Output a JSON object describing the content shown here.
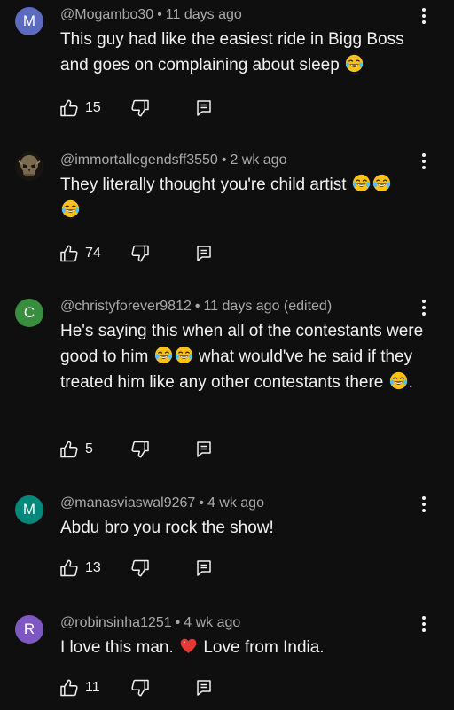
{
  "colors": {
    "background": "#0f0f0f",
    "primary_text": "#f1f1f1",
    "secondary_text": "#aaaaaa"
  },
  "comments": [
    {
      "avatar_letter": "M",
      "avatar_color": "#5c6bc0",
      "username": "@Mogambo30",
      "separator": "•",
      "time": "11 days ago",
      "text_parts": [
        "This guy had like the easiest ride in Bigg Boss and goes on complaining about sleep "
      ],
      "likes": "15"
    },
    {
      "avatar_icon": "skull-avatar-icon",
      "username": "@immortallegendsff3550",
      "separator": "•",
      "time": "2 wk ago",
      "text_parts": [
        "They literally thought you're child artist "
      ],
      "likes": "74"
    },
    {
      "avatar_letter": "C",
      "avatar_color": "#388e3c",
      "username": "@christyforever9812",
      "separator": "•",
      "time": "11 days ago (edited)",
      "text_parts": [
        "He's saying this when all of the contestants were good to him ",
        " what would've he said if they treated him like any other contestants there ",
        "."
      ],
      "likes": "5"
    },
    {
      "avatar_letter": "M",
      "avatar_color": "#00897b",
      "username": "@manasviaswal9267",
      "separator": "•",
      "time": "4 wk ago",
      "text_parts": [
        "Abdu bro you rock the show!"
      ],
      "likes": "13"
    },
    {
      "avatar_letter": "R",
      "avatar_color": "#7e57c2",
      "username": "@robinsinha1251",
      "separator": "•",
      "time": "4 wk ago",
      "text_parts": [
        "I love this man. ",
        " Love from India."
      ],
      "likes": "11"
    }
  ],
  "icons": {
    "like": "thumbs-up-icon",
    "dislike": "thumbs-down-icon",
    "reply": "reply-icon",
    "more": "more-vert-icon",
    "laugh_emoji": "face-with-tears-of-joy-emoji",
    "heart_emoji": "red-heart-emoji"
  }
}
